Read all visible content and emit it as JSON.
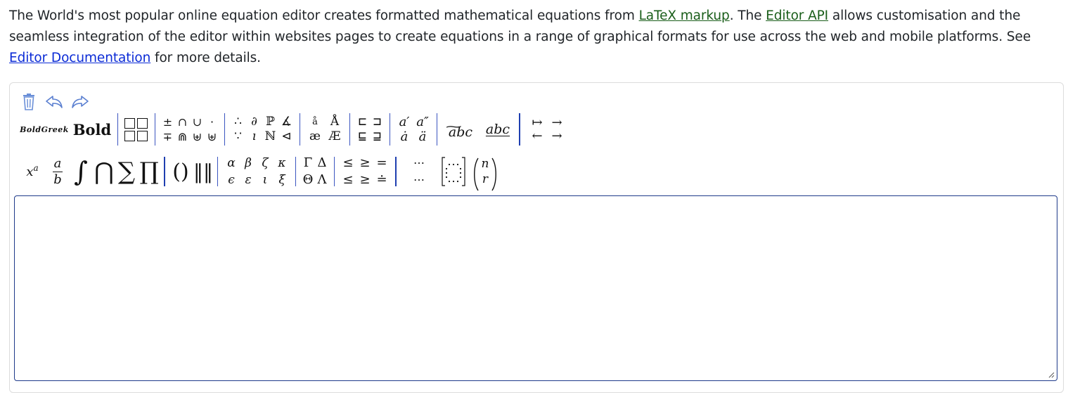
{
  "intro": {
    "text_1": "The World's most popular online equation editor creates formatted mathematical equations from ",
    "link_latex": "LaTeX markup",
    "text_2": ". The ",
    "link_api": "Editor API",
    "text_3": " allows customisation and the seamless integration of the editor within websites pages to create equations in a range of graphical formats for use across the web and mobile platforms. See ",
    "link_docs": "Editor Documentation",
    "text_4": " for more details."
  },
  "controls": {
    "icons": [
      "trash-icon",
      "undo-icon",
      "redo-icon"
    ]
  },
  "toolbar_row1": {
    "bold_greek": "BoldGreek",
    "bold": "Bold",
    "ops_top": [
      "±",
      "∩",
      "∪",
      "·"
    ],
    "ops_bottom": [
      "∓",
      "⋒",
      "⊎",
      "⊎"
    ],
    "misc_top": [
      "∴",
      "∂",
      "ℙ",
      "∡"
    ],
    "misc_bottom": [
      "∵",
      "ı",
      "ℕ",
      "⊲"
    ],
    "accent_top": [
      "å",
      "Å"
    ],
    "accent_bottom": [
      "æ",
      "Æ"
    ],
    "sqsub_top": [
      "⊏",
      "⊐"
    ],
    "sqsub_bottom": [
      "⊑",
      "⊒"
    ],
    "prime_top": [
      "a′",
      "a″"
    ],
    "prime_bottom": [
      "ȧ",
      "ä"
    ],
    "wide_tilde": "abc",
    "underline": "abc",
    "arrows_top": [
      "↦",
      "→"
    ],
    "arrows_bottom": [
      "←",
      "→"
    ]
  },
  "toolbar_row2": {
    "power": "x",
    "power_sup": "a",
    "frac_num": "a",
    "frac_den": "b",
    "big_ops": [
      "∫",
      "⋂",
      "∑",
      "∏"
    ],
    "delims": [
      "(",
      ")",
      "‖",
      "‖"
    ],
    "greek_top": [
      "α",
      "β",
      "ζ",
      "κ"
    ],
    "greek_bottom": [
      "ϵ",
      "ε",
      "ι",
      "ξ"
    ],
    "upper_top": [
      "Γ",
      "Δ"
    ],
    "upper_bottom": [
      "Θ",
      "Λ"
    ],
    "rel_top": [
      "≤",
      "≥",
      "="
    ],
    "rel_bottom": [
      "≤",
      "≥",
      "≐"
    ],
    "dots_top": "⋯",
    "dots_bottom": "⋯",
    "matrix_dots": "⋯",
    "binom_top": "n",
    "binom_bottom": "r"
  },
  "input": {
    "value": ""
  }
}
